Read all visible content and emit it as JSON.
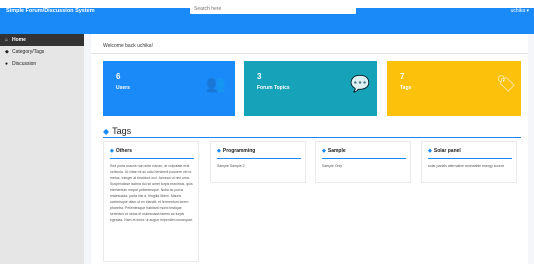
{
  "topbar": {
    "brand": "Simple Forum/Discussion System",
    "search_placeholder": "Search here",
    "user_label": "uchika ▾"
  },
  "sidebar": {
    "items": [
      {
        "label": "Home",
        "icon": "home-icon",
        "glyph": "⌂"
      },
      {
        "label": "Category/Tags",
        "icon": "tag-icon",
        "glyph": "◆"
      },
      {
        "label": "Discussion",
        "icon": "comments-icon",
        "glyph": "●"
      }
    ]
  },
  "main": {
    "welcome": "Welcome back uchika!",
    "cards": [
      {
        "count": "6",
        "label": "Users",
        "icon": "users-icon",
        "glyph": "👥",
        "color": "#1a8af8"
      },
      {
        "count": "3",
        "label": "Forum Topics",
        "icon": "comments-icon",
        "glyph": "💬",
        "color": "#16a2b9"
      },
      {
        "count": "7",
        "label": "Tags",
        "icon": "tags-icon",
        "glyph": "🏷",
        "color": "#fcc10a"
      }
    ],
    "tags_heading": "Tags",
    "tags": [
      {
        "name": "Others",
        "description": "Sed porta mauris non ante rutrum, at vulputate erat vehicula. Ut vitae mi ac odio hendrerit posuere vel ut metus. Integer at tincidunt orci. Aenean ut nisi urna. Suspendisse lacinia dui sit amet turpis maximus, quis elementum neque pellentesque. Nulla ac purus malesuada, porta nisi a, fringilla libero. Mauris scelerisque diam ut ex blandit, et fermentum lorem pharetra. Pellentesque habitant morbi tristique senectus et netus et malesuada fames ac turpis egestas. Nam et tortor ut augue imperdiet consequat."
      },
      {
        "name": "Programming",
        "description": "Sample Sample 2"
      },
      {
        "name": "Sample",
        "description": "Sample Only"
      },
      {
        "name": "Solar panel",
        "description": "solar panels alternative renewable energy source"
      }
    ]
  },
  "colors": {
    "accent": "#1a8af8",
    "info": "#16a2b9",
    "warning": "#fcc10a",
    "sidebar_bg": "#e6e6e6",
    "sidebar_active": "#333333"
  }
}
